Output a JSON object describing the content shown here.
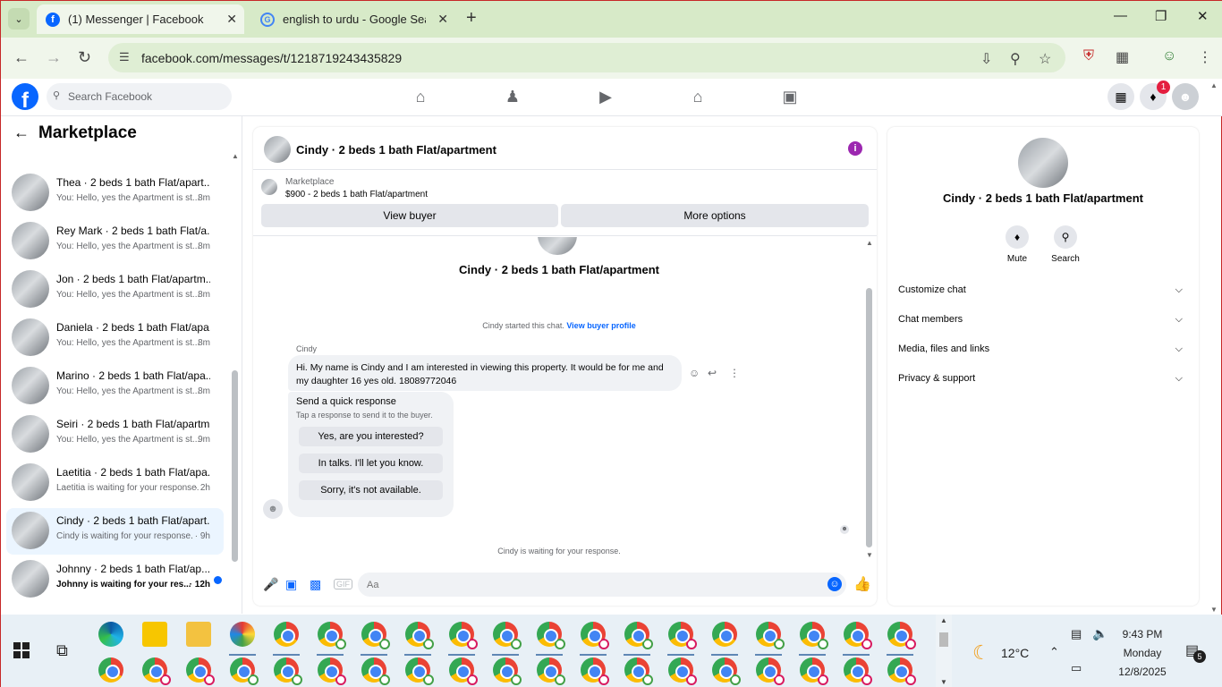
{
  "browser": {
    "tabs": [
      {
        "title": "(1) Messenger | Facebook",
        "active": true
      },
      {
        "title": "english to urdu - Google Search",
        "active": false
      }
    ],
    "url": "facebook.com/messages/t/1218719243435829"
  },
  "fb_header": {
    "logo": "f",
    "search_placeholder": "Search Facebook",
    "notification_badge": "1"
  },
  "left_panel": {
    "title": "Marketplace",
    "conversations": [
      {
        "name": "",
        "preview": "You: Hello, yes the Apartment is st...",
        "time": "8m"
      },
      {
        "name": "Thea · 2 beds 1 bath Flat/apart...",
        "preview": "You: Hello, yes the Apartment is st...",
        "time": "8m"
      },
      {
        "name": "Rey Mark · 2 beds 1 bath Flat/a...",
        "preview": "You: Hello, yes the Apartment is st...",
        "time": "8m"
      },
      {
        "name": "Jon · 2 beds 1 bath Flat/apartm...",
        "preview": "You: Hello, yes the Apartment is st...",
        "time": "8m"
      },
      {
        "name": "Daniela · 2 beds 1 bath Flat/apa...",
        "preview": "You: Hello, yes the Apartment is st...",
        "time": "8m"
      },
      {
        "name": "Marino · 2 beds 1 bath Flat/apa...",
        "preview": "You: Hello, yes the Apartment is st...",
        "time": "8m"
      },
      {
        "name": "Seiri · 2 beds 1 bath Flat/apartm...",
        "preview": "You: Hello, yes the Apartment is st...",
        "time": "9m"
      },
      {
        "name": "Laetitia · 2 beds 1 bath Flat/apa...",
        "preview": "Laetitia is waiting for your response.",
        "time": "· 2h"
      },
      {
        "name": "Cindy · 2 beds 1 bath Flat/apart...",
        "preview": "Cindy is waiting for your response.",
        "time": "· 9h",
        "selected": true
      },
      {
        "name": "Johnny · 2 beds 1 bath Flat/ap...",
        "preview": "Johnny is waiting for your res...",
        "time": "· 12h",
        "unread": true
      }
    ]
  },
  "chat": {
    "title": "Cindy · 2 beds 1 bath Flat/apartment",
    "marketplace_label": "Marketplace",
    "listing": "$900 - 2 beds 1 bath Flat/apartment",
    "view_buyer": "View buyer",
    "more_options": "More options",
    "big_title": "Cindy · 2 beds 1 bath Flat/apartment",
    "started_text": "Cindy started this chat.",
    "view_buyer_profile": "View buyer profile",
    "sender": "Cindy",
    "message": "Hi. My name is Cindy and I am interested in viewing this property. It would be for me and my daughter 16 yes old. 18089772046",
    "quick_title": "Send a quick response",
    "quick_sub": "Tap a response to send it to the buyer.",
    "quick_replies": [
      "Yes, are you interested?",
      "In talks. I'll let you know.",
      "Sorry, it's not available."
    ],
    "waiting": "Cindy is waiting for your response.",
    "composer_placeholder": "Aa"
  },
  "right_panel": {
    "title": "Cindy · 2 beds 1 bath Flat/apartment",
    "mute": "Mute",
    "search": "Search",
    "sections": [
      "Customize chat",
      "Chat members",
      "Media, files and links",
      "Privacy & support"
    ]
  },
  "taskbar": {
    "temperature": "12°C",
    "time": "9:43 PM",
    "day": "Monday",
    "date": "12/8/2025",
    "notification_count": "5"
  }
}
